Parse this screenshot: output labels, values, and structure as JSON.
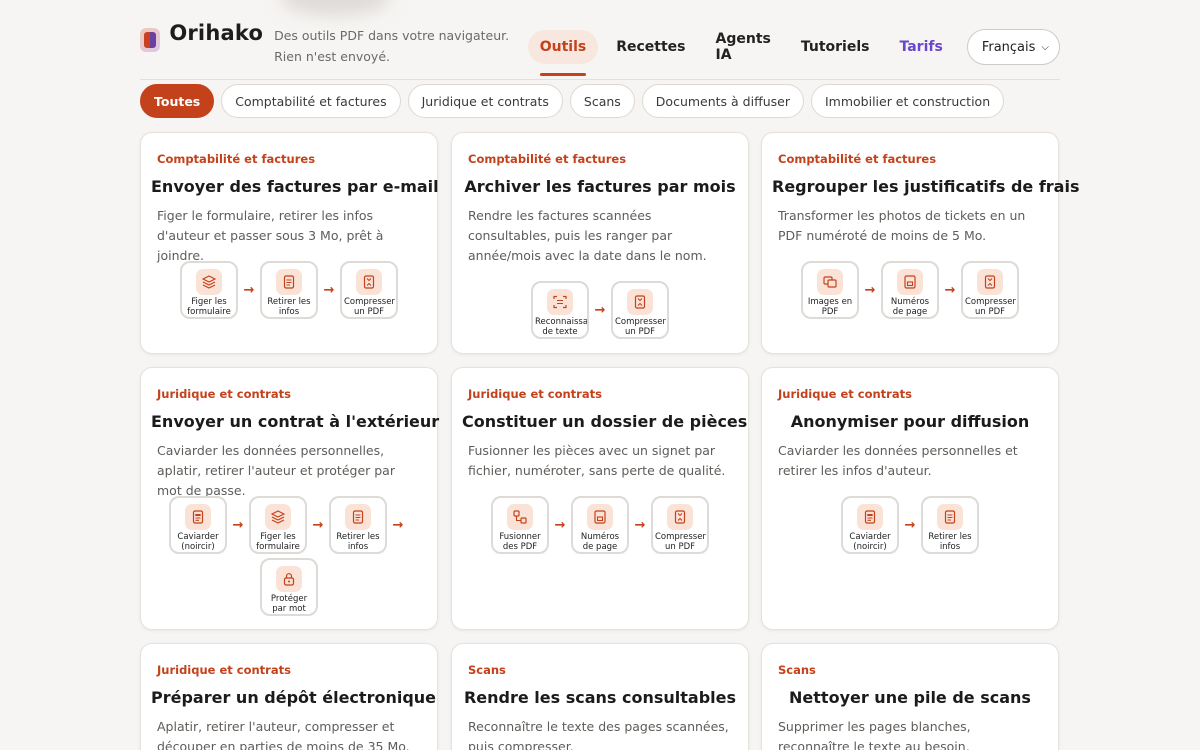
{
  "app": {
    "brand": "Orihako",
    "tagline": "Des outils PDF dans votre navigateur. Rien n'est envoyé."
  },
  "nav": {
    "items": [
      {
        "label": "Outils",
        "active": true
      },
      {
        "label": "Recettes"
      },
      {
        "label": "Agents IA"
      },
      {
        "label": "Tutoriels"
      },
      {
        "label": "Tarifs",
        "accent": "#6a46c9"
      }
    ],
    "language": "Français"
  },
  "filters": [
    "Toutes",
    "Comptabilité et factures",
    "Juridique et contrats",
    "Scans",
    "Documents à diffuser",
    "Immobilier et construction"
  ],
  "colors": {
    "accent": "#c4421b",
    "pricing": "#6a46c9",
    "icon_bg": "#fbe2d6"
  },
  "cards": [
    {
      "category": "Comptabilité et factures",
      "title": "Envoyer des factures par e-mail",
      "description": "Figer le formulaire, retirer les infos d'auteur et passer sous 3 Mo, prêt à joindre.",
      "steps": [
        {
          "icon": "layers-icon",
          "label": "Figer les formulaire"
        },
        {
          "icon": "document-icon",
          "label": "Retirer les infos"
        },
        {
          "icon": "compress-icon",
          "label": "Compresser un PDF"
        }
      ]
    },
    {
      "category": "Comptabilité et factures",
      "title": "Archiver les factures par mois",
      "description": "Rendre les factures scannées consultables, puis les ranger par année/mois avec la date dans le nom.",
      "steps": [
        {
          "icon": "scan-icon",
          "label": "Reconnaissance de texte"
        },
        {
          "icon": "compress-icon",
          "label": "Compresser un PDF"
        }
      ]
    },
    {
      "category": "Comptabilité et factures",
      "title": "Regrouper les justificatifs de frais",
      "description": "Transformer les photos de tickets en un PDF numéroté de moins de 5 Mo.",
      "steps": [
        {
          "icon": "images-icon",
          "label": "Images en PDF"
        },
        {
          "icon": "page-number-icon",
          "label": "Numéros de page"
        },
        {
          "icon": "compress-icon",
          "label": "Compresser un PDF"
        }
      ]
    },
    {
      "category": "Juridique et contrats",
      "title": "Envoyer un contrat à l'extérieur",
      "description": "Caviarder les données personnelles, aplatir, retirer l'auteur et protéger par mot de passe.",
      "steps": [
        {
          "icon": "redact-icon",
          "label": "Caviarder (noircir)"
        },
        {
          "icon": "layers-icon",
          "label": "Figer les formulaire"
        },
        {
          "icon": "document-icon",
          "label": "Retirer les infos"
        },
        {
          "icon": "lock-icon",
          "label": "Protéger par mot"
        }
      ]
    },
    {
      "category": "Juridique et contrats",
      "title": "Constituer un dossier de pièces",
      "description": "Fusionner les pièces avec un signet par fichier, numéroter, sans perte de qualité.",
      "steps": [
        {
          "icon": "merge-icon",
          "label": "Fusionner des PDF"
        },
        {
          "icon": "page-number-icon",
          "label": "Numéros de page"
        },
        {
          "icon": "compress-icon",
          "label": "Compresser un PDF"
        }
      ]
    },
    {
      "category": "Juridique et contrats",
      "title": "Anonymiser pour diffusion",
      "description": "Caviarder les données personnelles et retirer les infos d'auteur.",
      "steps": [
        {
          "icon": "redact-icon",
          "label": "Caviarder (noircir)"
        },
        {
          "icon": "document-icon",
          "label": "Retirer les infos"
        }
      ]
    },
    {
      "category": "Juridique et contrats",
      "title": "Préparer un dépôt électronique",
      "description": "Aplatir, retirer l'auteur, compresser et découper en parties de moins de 35 Mo.",
      "steps": []
    },
    {
      "category": "Scans",
      "title": "Rendre les scans consultables",
      "description": "Reconnaître le texte des pages scannées, puis compresser.",
      "steps": []
    },
    {
      "category": "Scans",
      "title": "Nettoyer une pile de scans",
      "description": "Supprimer les pages blanches, reconnaître le texte au besoin, compresser.",
      "steps": []
    }
  ]
}
